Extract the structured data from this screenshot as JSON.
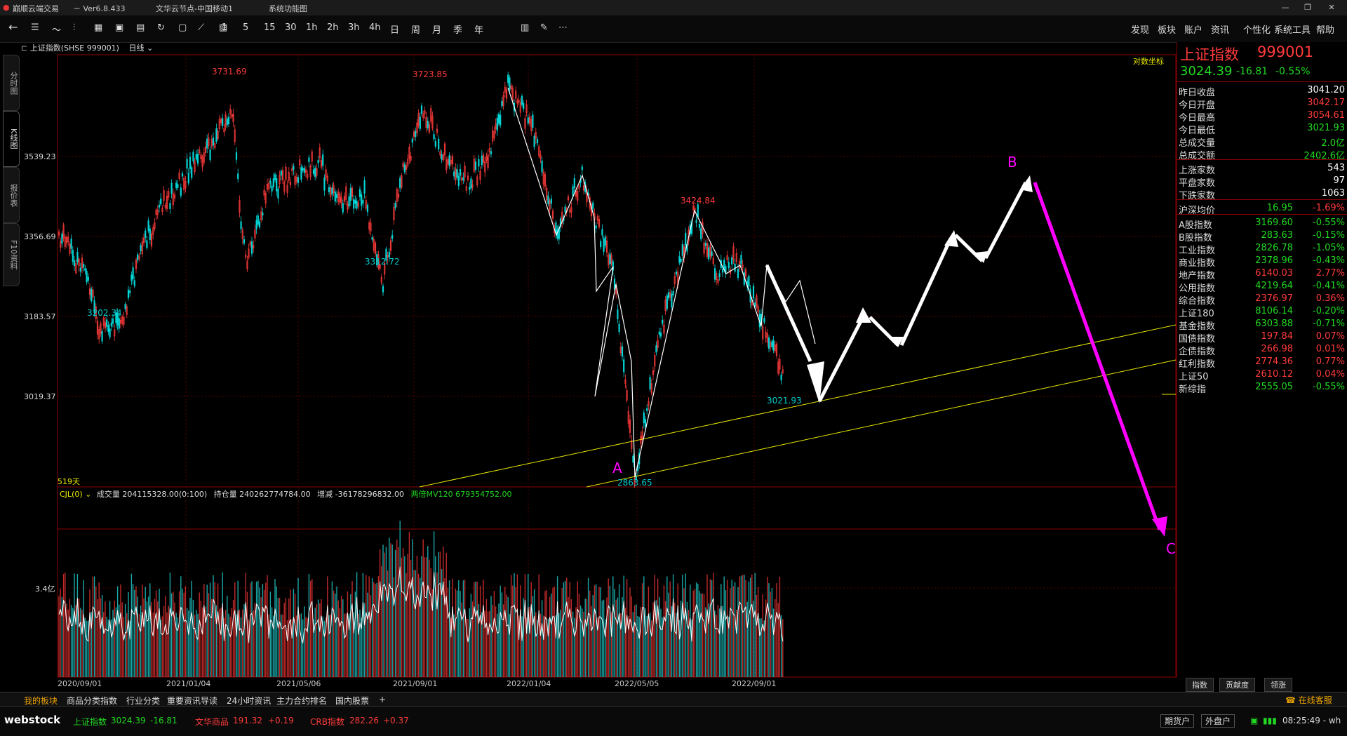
{
  "titlebar": {
    "app_name": "巅顺云端交易",
    "version": "－ Ver6.8.433",
    "node": "文华云节点-中国移动1",
    "menu": "系统功能图"
  },
  "toolbar": {
    "periods": [
      "1",
      "5",
      "15",
      "30",
      "1h",
      "2h",
      "3h",
      "4h",
      "日",
      "周",
      "月",
      "季",
      "年"
    ],
    "right_menu": [
      "发现",
      "板块",
      "账户",
      "资讯",
      "个性化",
      "系统工具",
      "帮助"
    ]
  },
  "left_tabs": [
    "分时图",
    "K线图",
    "报价表",
    "F10资料"
  ],
  "chart_header": {
    "symbol": "上证指数(SHSE 999001)",
    "period": "日线",
    "log_label": "对数坐标",
    "days_label": "519天"
  },
  "price_axis": [
    "3539.23",
    "3356.69",
    "3183.57",
    "3019.37"
  ],
  "volume_axis": [
    "3.4亿"
  ],
  "date_axis": [
    "2020/09/01",
    "2021/01/04",
    "2021/05/06",
    "2021/09/01",
    "2022/01/04",
    "2022/05/05",
    "2022/09/01"
  ],
  "annotations": {
    "high1": "3731.69",
    "high2": "3723.85",
    "low1": "3312.72",
    "low2": "3202.34",
    "high3": "3424.84",
    "last": "3021.93",
    "low3": "2863.65",
    "wave_a": "A",
    "wave_b": "B",
    "wave_c": "C"
  },
  "volume_header": {
    "indicator": "CJL(0)",
    "volume": "成交量 204115328.00(0:100)",
    "open_interest": "持仓量 240262774784.00",
    "change": "增减 -36178296832.00",
    "ma": "两倍MV120 679354752.00"
  },
  "quote": {
    "name": "上证指数",
    "code": "999001",
    "price": "3024.39",
    "change": "-16.81",
    "pct": "-0.55%",
    "rows": [
      {
        "label": "昨日收盘",
        "value": "3041.20",
        "color": "#ffffff"
      },
      {
        "label": "今日开盘",
        "value": "3042.17",
        "color": "#ff3b3b"
      },
      {
        "label": "今日最高",
        "value": "3054.61",
        "color": "#ff3b3b"
      },
      {
        "label": "今日最低",
        "value": "3021.93",
        "color": "#22d922"
      },
      {
        "label": "总成交量",
        "value": "2.0亿",
        "color": "#22d922"
      },
      {
        "label": "总成交额",
        "value": "2402.6亿",
        "color": "#22d922"
      }
    ],
    "breadth": [
      {
        "label": "上涨家数",
        "value": "543"
      },
      {
        "label": "平盘家数",
        "value": "97"
      },
      {
        "label": "下跌家数",
        "value": "1063"
      }
    ],
    "avg": {
      "label": "沪深均价",
      "value": "16.95",
      "pct": "-1.69%"
    },
    "indices": [
      {
        "label": "A股指数",
        "value": "3169.60",
        "pct": "-0.55%",
        "up": false
      },
      {
        "label": "B股指数",
        "value": "283.63",
        "pct": "-0.15%",
        "up": false
      },
      {
        "label": "工业指数",
        "value": "2826.78",
        "pct": "-1.05%",
        "up": false
      },
      {
        "label": "商业指数",
        "value": "2378.96",
        "pct": "-0.43%",
        "up": false
      },
      {
        "label": "地产指数",
        "value": "6140.03",
        "pct": "2.77%",
        "up": true
      },
      {
        "label": "公用指数",
        "value": "4219.64",
        "pct": "-0.41%",
        "up": false
      },
      {
        "label": "综合指数",
        "value": "2376.97",
        "pct": "0.36%",
        "up": true
      },
      {
        "label": "上证180",
        "value": "8106.14",
        "pct": "-0.20%",
        "up": false
      },
      {
        "label": "基金指数",
        "value": "6303.88",
        "pct": "-0.71%",
        "up": false
      },
      {
        "label": "国债指数",
        "value": "197.84",
        "pct": "0.07%",
        "up": true
      },
      {
        "label": "企债指数",
        "value": "266.98",
        "pct": "0.01%",
        "up": true
      },
      {
        "label": "红利指数",
        "value": "2774.36",
        "pct": "0.77%",
        "up": true
      },
      {
        "label": "上证50",
        "value": "2610.12",
        "pct": "0.04%",
        "up": true
      },
      {
        "label": "新综指",
        "value": "2555.05",
        "pct": "-0.55%",
        "up": false
      }
    ],
    "tabs": [
      "指数",
      "贡献度",
      "领涨"
    ]
  },
  "bottom_tabs": [
    "我的板块",
    "商品分类指数",
    "行业分类",
    "重要资讯导读",
    "24小时资讯",
    "主力合约排名",
    "国内股票"
  ],
  "online_label": "在线客服",
  "status": {
    "logo": "webstock",
    "tickers": [
      {
        "name": "上证指数",
        "value": "3024.39",
        "change": "-16.81"
      },
      {
        "name": "文华商品",
        "value": "191.32",
        "change": "+0.19"
      },
      {
        "name": "CRB指数",
        "value": "282.26",
        "change": "+0.37"
      }
    ],
    "btn_futures": "期货户",
    "btn_outer": "外盘户",
    "time": "08:25:49 - wh"
  },
  "colors": {
    "up": "#ff3b3b",
    "down": "#22d922",
    "cyan": "#00cccc",
    "magenta": "#ff00ff",
    "trend": "#e8e800"
  }
}
